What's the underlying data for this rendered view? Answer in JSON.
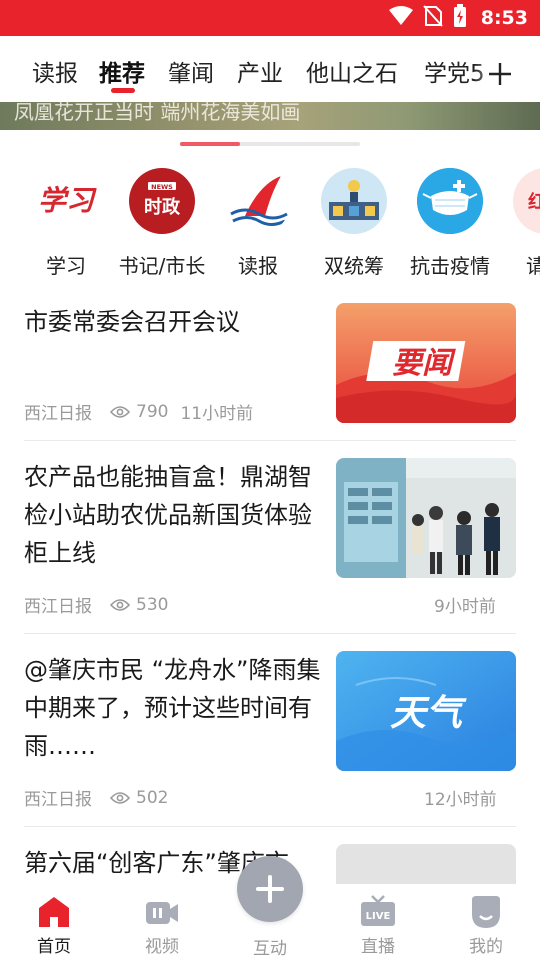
{
  "status_bar": {
    "time": "8:53",
    "icons": [
      "wifi-icon",
      "no-sim-icon",
      "battery-icon"
    ]
  },
  "tabs": {
    "items": [
      "读报",
      "推荐",
      "肇闻",
      "产业",
      "他山之石",
      "学党5"
    ],
    "active": "推荐",
    "add_icon": "plus-icon"
  },
  "banner": {
    "caption": "凤凰花开正当时 端州花海美如画"
  },
  "shortcuts": [
    {
      "label": "学习",
      "icon": "xuexi-logo-icon"
    },
    {
      "label": "书记/市长",
      "icon": "news-politics-icon",
      "icon_text_top": "NEWS",
      "icon_text": "时政"
    },
    {
      "label": "读报",
      "icon": "read-paper-icon"
    },
    {
      "label": "双统筹",
      "icon": "dual-coordination-icon"
    },
    {
      "label": "抗击疫情",
      "icon": "mask-icon"
    },
    {
      "label": "请您",
      "icon": "red-badge-icon",
      "icon_text": "红"
    }
  ],
  "news": [
    {
      "title": "市委常委会召开会议",
      "source": "西江日报",
      "views": "790",
      "time": "11小时前",
      "thumb_text": "要闻"
    },
    {
      "title": "农产品也能抽盲盒！鼎湖智检小站助农优品新国货体验柜上线",
      "source": "西江日报",
      "views": "530",
      "time": "9小时前",
      "thumb_text": ""
    },
    {
      "title": "@肇庆市民 “龙舟水”降雨集中期来了，预计这些时间有雨……",
      "source": "西江日报",
      "views": "502",
      "time": "12小时前",
      "thumb_text": "天气"
    },
    {
      "title": "第六届“创客广东”肇庆市",
      "source": "",
      "views": "",
      "time": "",
      "thumb_text": ""
    }
  ],
  "bottom_nav": {
    "items": [
      {
        "label": "首页",
        "icon": "home-icon",
        "active": true
      },
      {
        "label": "视频",
        "icon": "video-icon",
        "active": false
      },
      {
        "label": "互动",
        "icon": "plus-icon",
        "active": false
      },
      {
        "label": "直播",
        "icon": "live-icon",
        "active": false,
        "badge_text": "LIVE"
      },
      {
        "label": "我的",
        "icon": "profile-icon",
        "active": false
      }
    ]
  },
  "colors": {
    "brand_red": "#e8232c",
    "meta_gray": "#9a9a9a",
    "fab_gray": "#a1a6b1"
  }
}
